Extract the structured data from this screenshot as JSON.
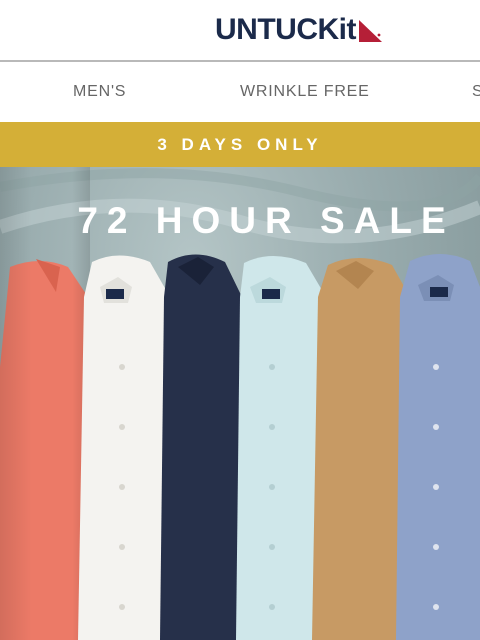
{
  "brand": {
    "name": "UNTUCKit"
  },
  "nav": {
    "items": [
      "MEN'S",
      "WRINKLE FREE",
      "S"
    ]
  },
  "promo": {
    "text": "3 DAYS ONLY",
    "color": "#d4af37"
  },
  "hero": {
    "title": "72 HOUR SALE",
    "shirts": [
      {
        "color": "coral",
        "hex": "#ec7a67"
      },
      {
        "color": "white",
        "hex": "#f4f3f0"
      },
      {
        "color": "navy",
        "hex": "#26304a"
      },
      {
        "color": "light-aqua",
        "hex": "#cfe7ea"
      },
      {
        "color": "tan",
        "hex": "#c79a64"
      },
      {
        "color": "chambray-blue",
        "hex": "#8ea2c9"
      }
    ]
  },
  "colors": {
    "brand_navy": "#1b2a4a",
    "brand_red": "#b51f37"
  }
}
